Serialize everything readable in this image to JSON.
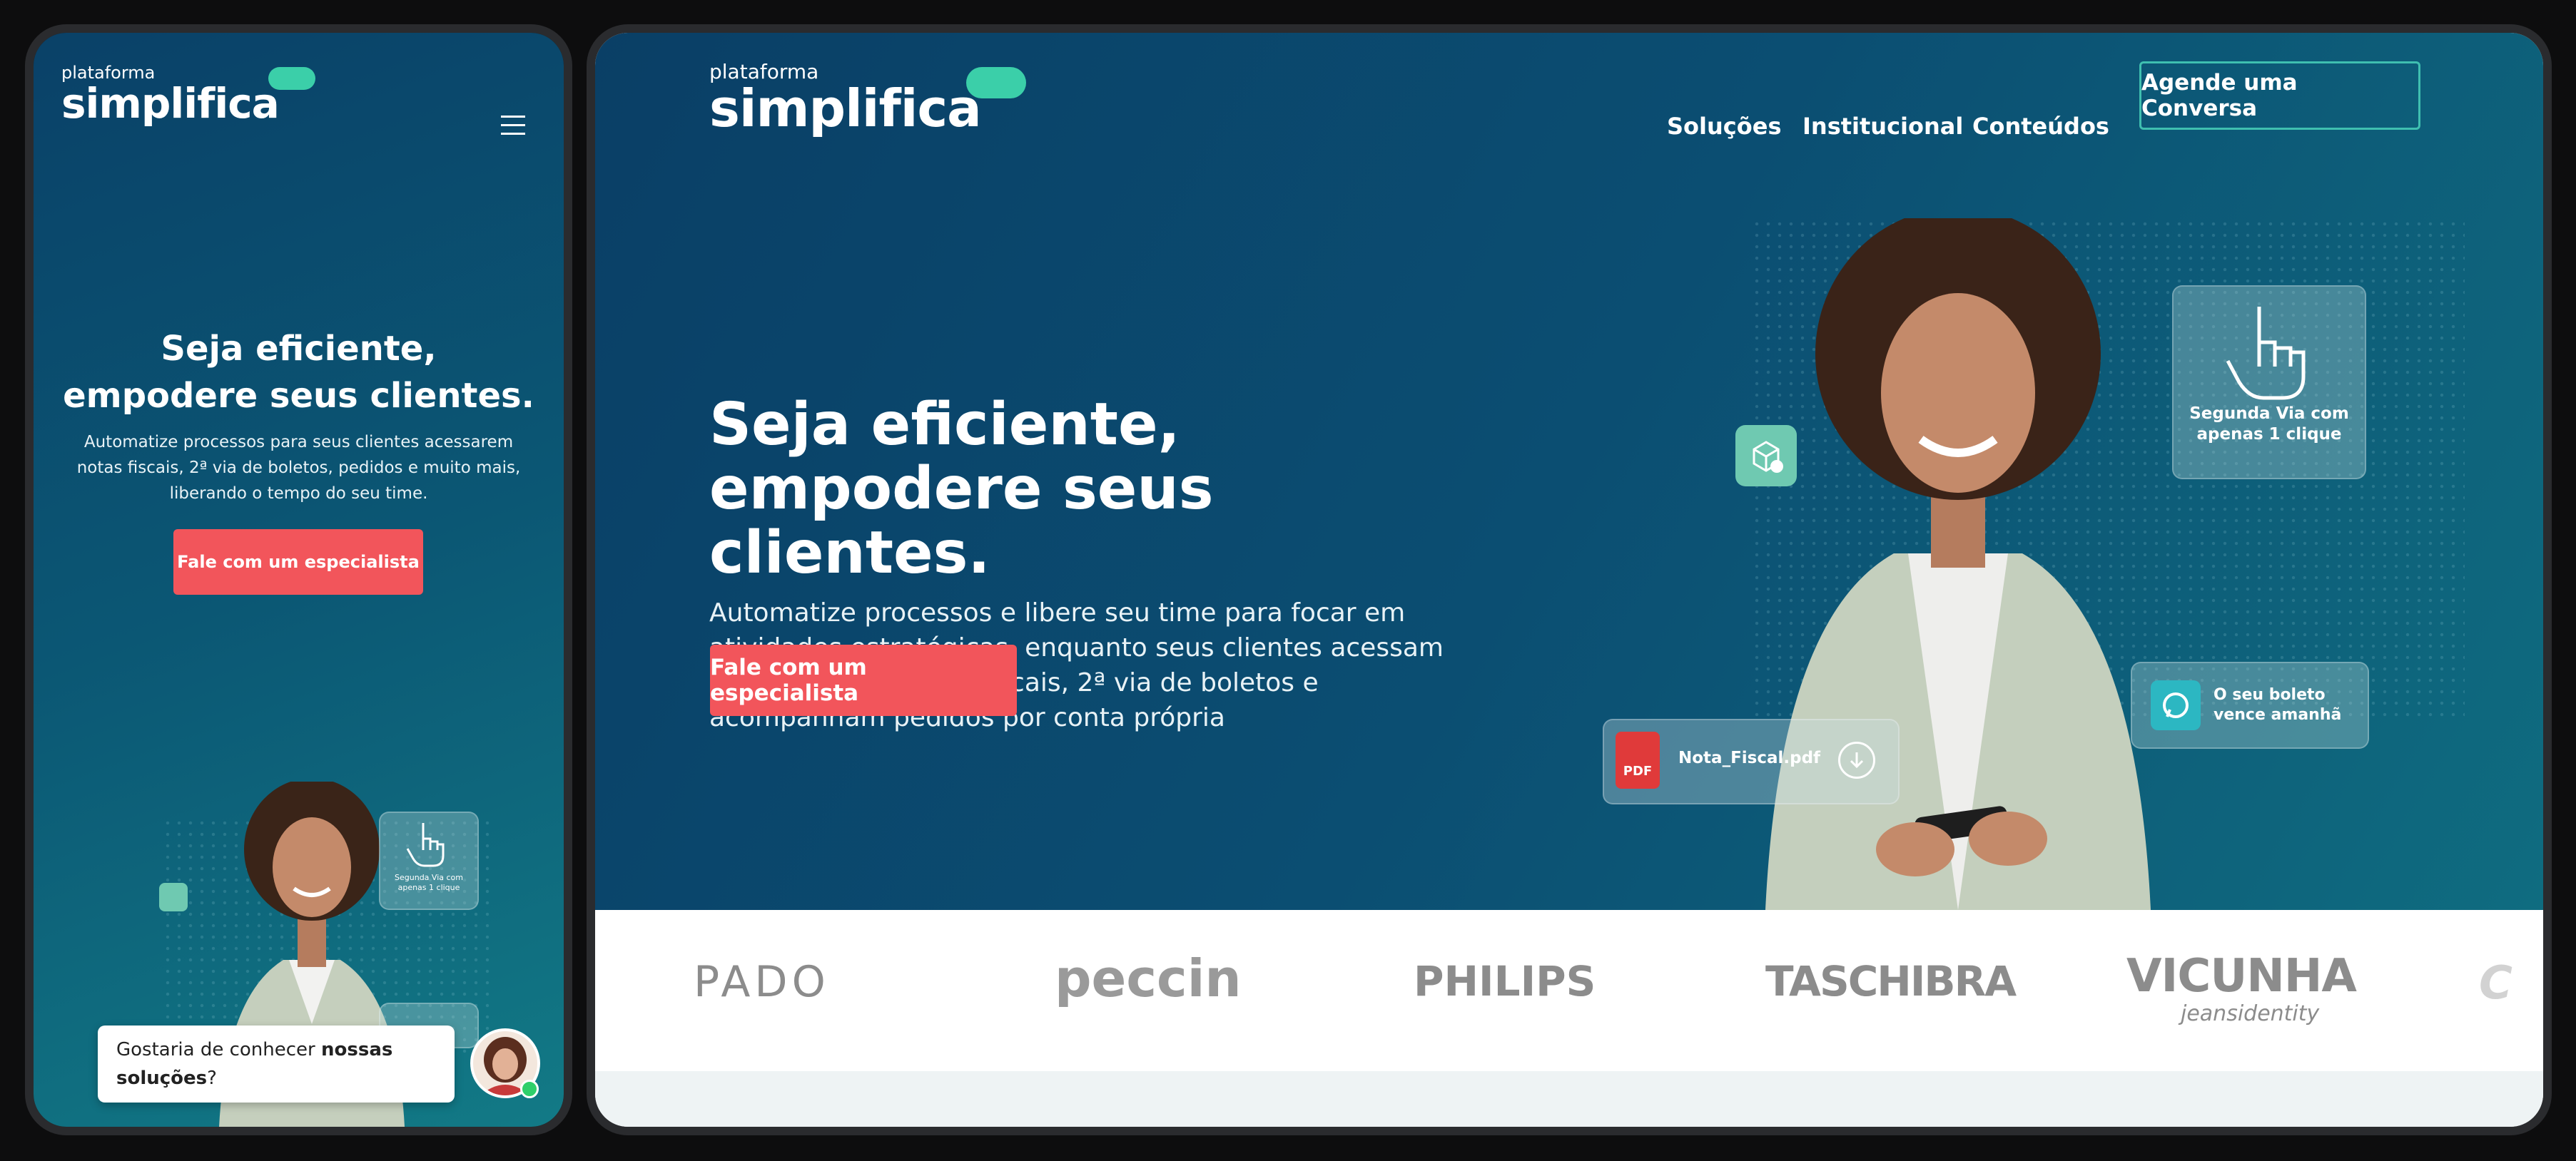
{
  "brand": {
    "pre": "plataforma",
    "name": "simplifica",
    "accent": "#3bcfa9"
  },
  "nav": {
    "links": [
      "Soluções",
      "Institucional",
      "Conteúdos"
    ],
    "cta": "Agende uma Conversa"
  },
  "hero": {
    "title_line1": "Seja eficiente,",
    "title_line2": "empodere seus clientes.",
    "desktop_text": "Automatize processos e libere seu time para focar em atividades estratégicas, enquanto seus clientes acessam serviços como notas fiscais, 2ª via de boletos e acompanham pedidos por conta própria",
    "mobile_text": "Automatize processos para seus clientes acessarem notas fiscais, 2ª via de boletos, pedidos e muito mais, liberando o tempo do seu time.",
    "cta": "Fale com um especialista",
    "cta_color": "#f2555b"
  },
  "cards": {
    "segunda_via": "Segunda Via com apenas 1 clique",
    "boleto": "O seu boleto vence amanhã",
    "file_name": "Nota_Fiscal.pdf",
    "file_badge": "PDF"
  },
  "clients": [
    "PADO",
    "peccin",
    "PHILIPS",
    "TASCHIBRA",
    "VICUNHA",
    "jeansidentity"
  ],
  "chat": {
    "prefix": "Gostaria de conhecer ",
    "bold": "nossas soluções",
    "suffix": "?"
  },
  "icons": {
    "menu": "hamburger-menu-icon",
    "hand": "pointer-hand-icon",
    "box": "package-check-icon",
    "whatsapp": "whatsapp-icon",
    "download": "download-icon"
  }
}
